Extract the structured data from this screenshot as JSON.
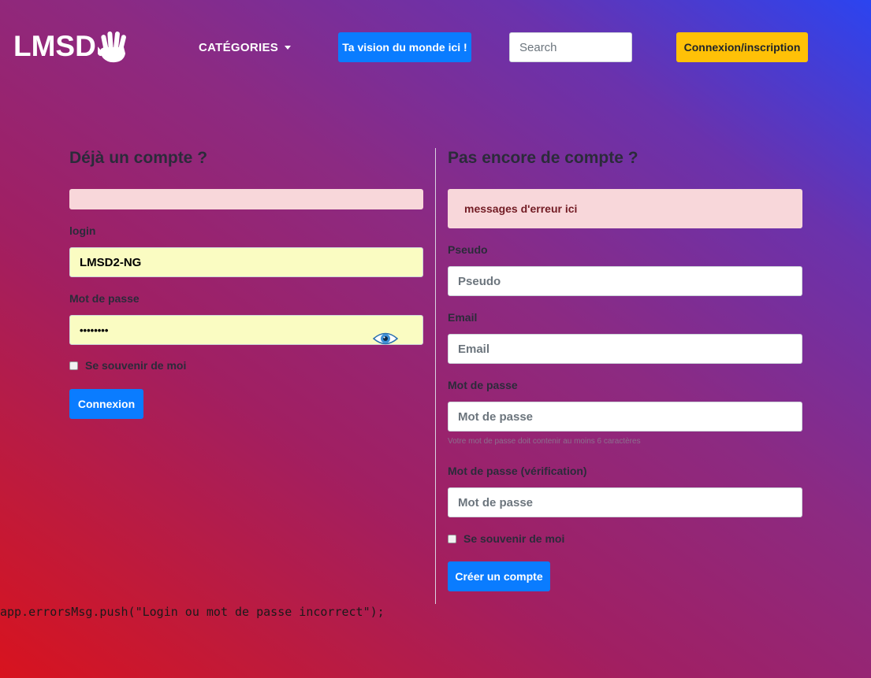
{
  "nav": {
    "logo_text": "LMSD",
    "categories_label": "CATÉGORIES",
    "vision_button": "Ta vision du monde ici !",
    "search_placeholder": "Search",
    "connect_button": "Connexion/inscription"
  },
  "login": {
    "heading": "Déjà un compte ?",
    "error_message": "",
    "login_label": "login",
    "login_value": "LMSD2-NG",
    "password_label": "Mot de passe",
    "password_value": "••••••••",
    "remember_label": "Se souvenir de moi",
    "submit_label": "Connexion"
  },
  "register": {
    "heading": "Pas encore de compte ?",
    "error_message": "messages d'erreur ici",
    "pseudo_label": "Pseudo",
    "pseudo_placeholder": "Pseudo",
    "email_label": "Email",
    "email_placeholder": "Email",
    "password_label": "Mot de passe",
    "password_placeholder": "Mot de passe",
    "password_hint": "Votre mot de passe doit contenir au moins 6 caractères",
    "password_confirm_label": "Mot de passe (vérification)",
    "password_confirm_placeholder": "Mot de passe",
    "remember_label": "Se souvenir de moi",
    "submit_label": "Créer un compte"
  },
  "debug_output": "app.errorsMsg.push(\"Login ou mot de passe incorrect\");",
  "colors": {
    "primary": "#0a7cff",
    "warning": "#ffc107",
    "alert_bg": "#f8d7da",
    "autofill_bg": "#fafcc2"
  }
}
